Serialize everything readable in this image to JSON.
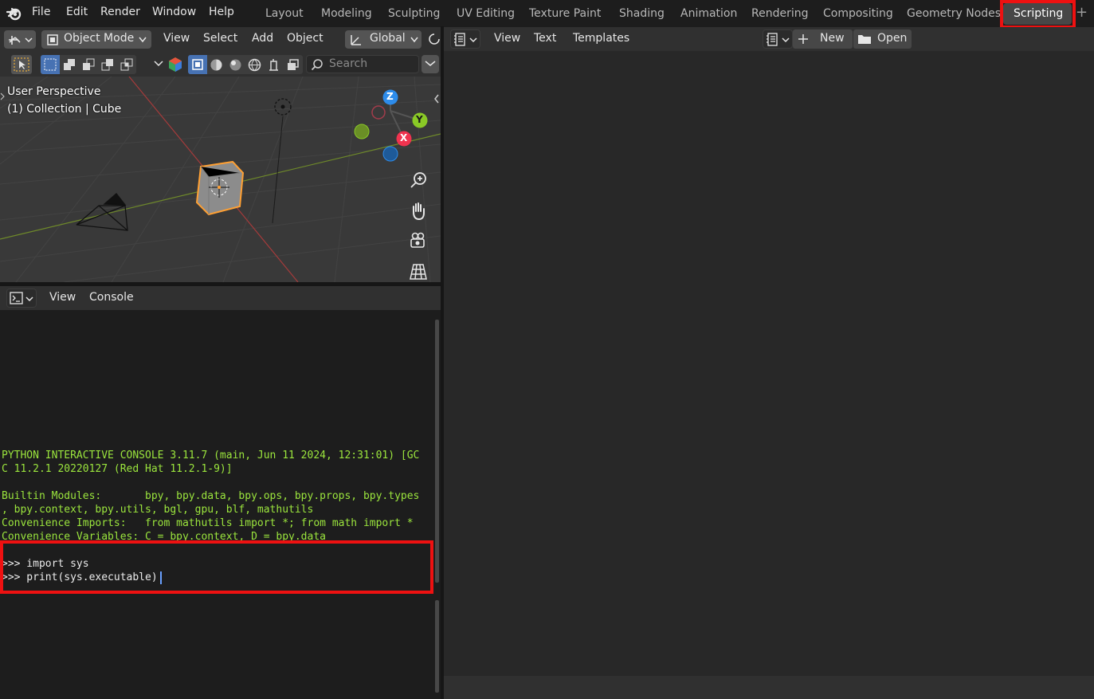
{
  "topbar": {
    "menus": [
      "File",
      "Edit",
      "Render",
      "Window",
      "Help"
    ],
    "workspaces": [
      "Layout",
      "Modeling",
      "Sculpting",
      "UV Editing",
      "Texture Paint",
      "Shading",
      "Animation",
      "Rendering",
      "Compositing",
      "Geometry Nodes",
      "Scripting"
    ],
    "active_workspace": "Scripting",
    "add_tab": "+"
  },
  "viewport_header": {
    "mode": "Object Mode",
    "menus": [
      "View",
      "Select",
      "Add",
      "Object"
    ],
    "transform_orientation": "Global"
  },
  "viewport_toolbar": {
    "search_placeholder": "Search"
  },
  "viewport": {
    "perspective_label": "User Perspective",
    "collection_label": "(1) Collection | Cube",
    "gizmo": {
      "z": "Z",
      "y": "Y",
      "x": "X"
    }
  },
  "console_header": {
    "menus": [
      "View",
      "Console"
    ]
  },
  "console": {
    "banner_1": "PYTHON INTERACTIVE CONSOLE 3.11.7 (main, Jun 11 2024, 12:31:01) [GC",
    "banner_2": "C 11.2.1 20220127 (Red Hat 11.2.1-9)]",
    "builtin_1": "Builtin Modules:       bpy, bpy.data, bpy.ops, bpy.props, bpy.types",
    "builtin_2": ", bpy.context, bpy.utils, bgl, gpu, blf, mathutils",
    "convenience_imports": "Convenience Imports:   from mathutils import *; from math import *",
    "convenience_vars": "Convenience Variables: C = bpy.context, D = bpy.data",
    "input_1": ">>> import sys",
    "input_2": ">>> print(sys.executable)"
  },
  "text_editor": {
    "menus": [
      "View",
      "Text",
      "Templates"
    ],
    "new_label": "New",
    "open_label": "Open"
  },
  "colors": {
    "highlight": "#ee1111",
    "console_output": "#9be53d",
    "axis_x": "#f0334f",
    "axis_y": "#8ac926",
    "axis_z": "#2d8ceb",
    "selected_outline": "#ffa033"
  }
}
